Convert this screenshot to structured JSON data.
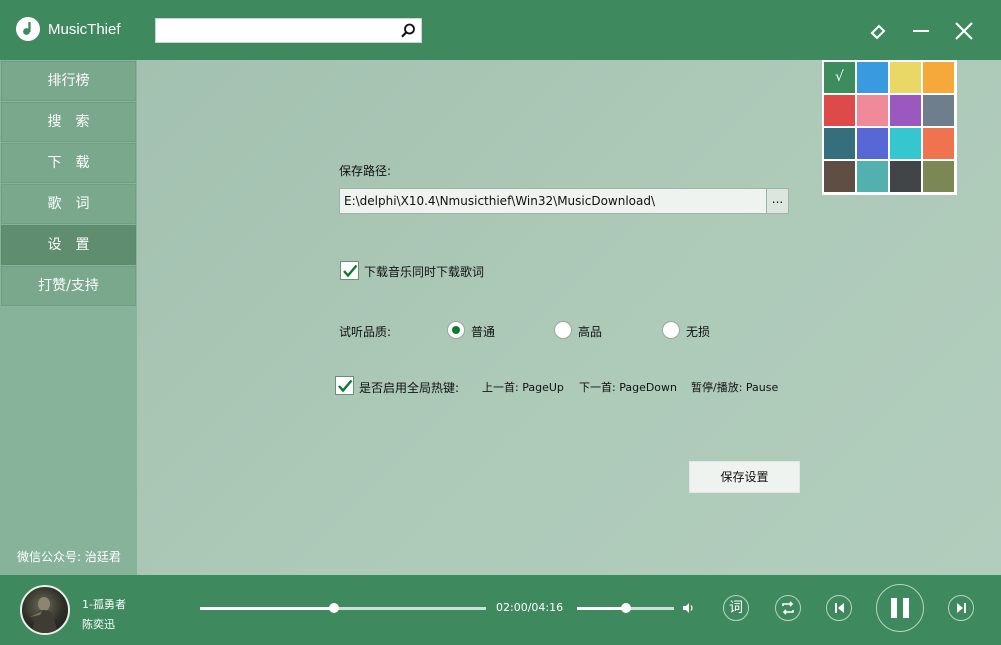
{
  "app": {
    "name": "MusicThief",
    "search": {
      "value": "",
      "placeholder": ""
    }
  },
  "sidebar": {
    "items": [
      {
        "label": "排行榜"
      },
      {
        "label": "搜　索"
      },
      {
        "label": "下　载"
      },
      {
        "label": "歌　词"
      },
      {
        "label": "设　置",
        "active": true
      },
      {
        "label": "打赞/支持"
      }
    ],
    "wechat": "微信公众号: 治廷君"
  },
  "theme": {
    "selected": "#3d8c5e",
    "selected_mark": "√",
    "colors": [
      "#3d8c5e",
      "#3a9ae0",
      "#ead866",
      "#f5a93a",
      "#de4949",
      "#f08a9a",
      "#9b58be",
      "#6e7e8c",
      "#356f7e",
      "#5867d6",
      "#36c6cf",
      "#f07350",
      "#5e4e44",
      "#52b1ae",
      "#424547",
      "#7b8855"
    ]
  },
  "settings": {
    "save_path_label": "保存路径:",
    "save_path_value": "E:\\delphi\\X10.4\\Nmusicthief\\Win32\\MusicDownload\\",
    "browse_label": "...",
    "lyrics_checkbox_label": "下载音乐同时下载歌词",
    "lyrics_checked": true,
    "quality_label": "试听品质:",
    "quality_options": [
      {
        "label": "普通",
        "selected": true
      },
      {
        "label": "高品",
        "selected": false
      },
      {
        "label": "无损",
        "selected": false
      }
    ],
    "hotkey_checkbox_label": "是否启用全局热键:",
    "hotkey_checked": true,
    "hotkey_prev": "上一首:  PageUp",
    "hotkey_next": "下一首:  PageDown",
    "hotkey_pause": "暂停/播放:  Pause",
    "save_button": "保存设置"
  },
  "player": {
    "song": "1-孤勇者",
    "artist": "陈奕迅",
    "time": "02:00/04:16",
    "progress": 0.47,
    "volume": 0.5,
    "lyrics_button": "词"
  }
}
